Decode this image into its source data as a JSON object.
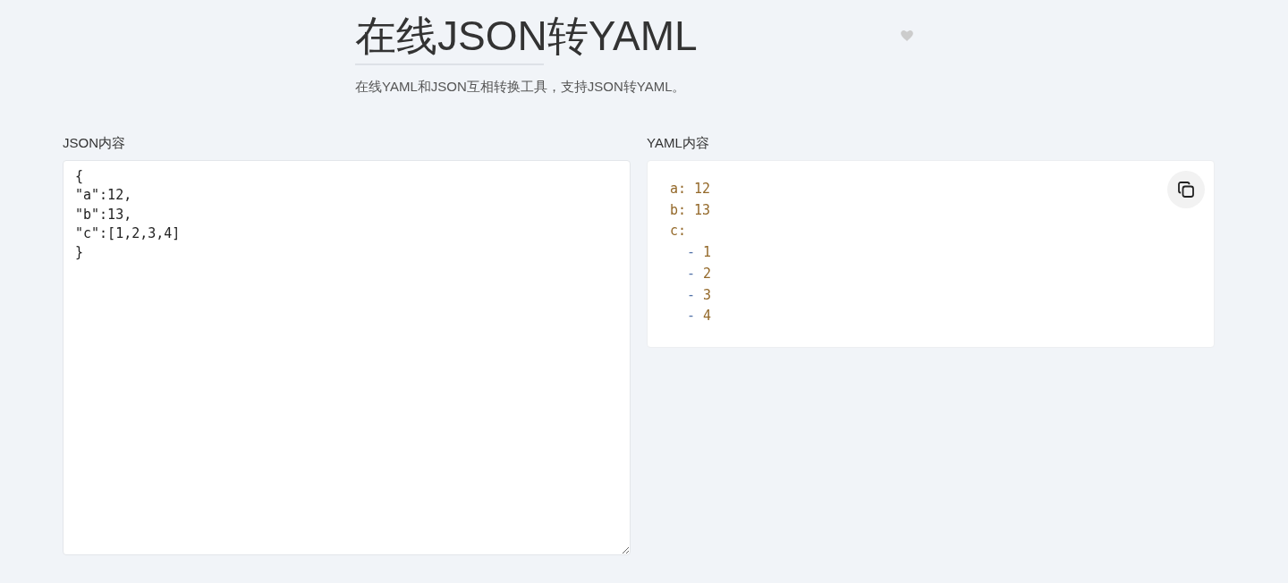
{
  "header": {
    "title": "在线JSON转YAML",
    "subtitle": "在线YAML和JSON互相转换工具，支持JSON转YAML。"
  },
  "input": {
    "label": "JSON内容",
    "lines": [
      "{",
      "\"a\":12,",
      "\"b\":13,",
      "\"c\":[1,2,3,4]",
      "}"
    ]
  },
  "output": {
    "label": "YAML内容",
    "lines": [
      {
        "kind": "pair",
        "key": "a:",
        "value": "12"
      },
      {
        "kind": "pair",
        "key": "b:",
        "value": "13"
      },
      {
        "kind": "pair",
        "key": "c:"
      },
      {
        "kind": "item",
        "dash": "-",
        "value": "1"
      },
      {
        "kind": "item",
        "dash": "-",
        "value": "2"
      },
      {
        "kind": "item",
        "dash": "-",
        "value": "3"
      },
      {
        "kind": "item",
        "dash": "-",
        "value": "4"
      }
    ]
  }
}
